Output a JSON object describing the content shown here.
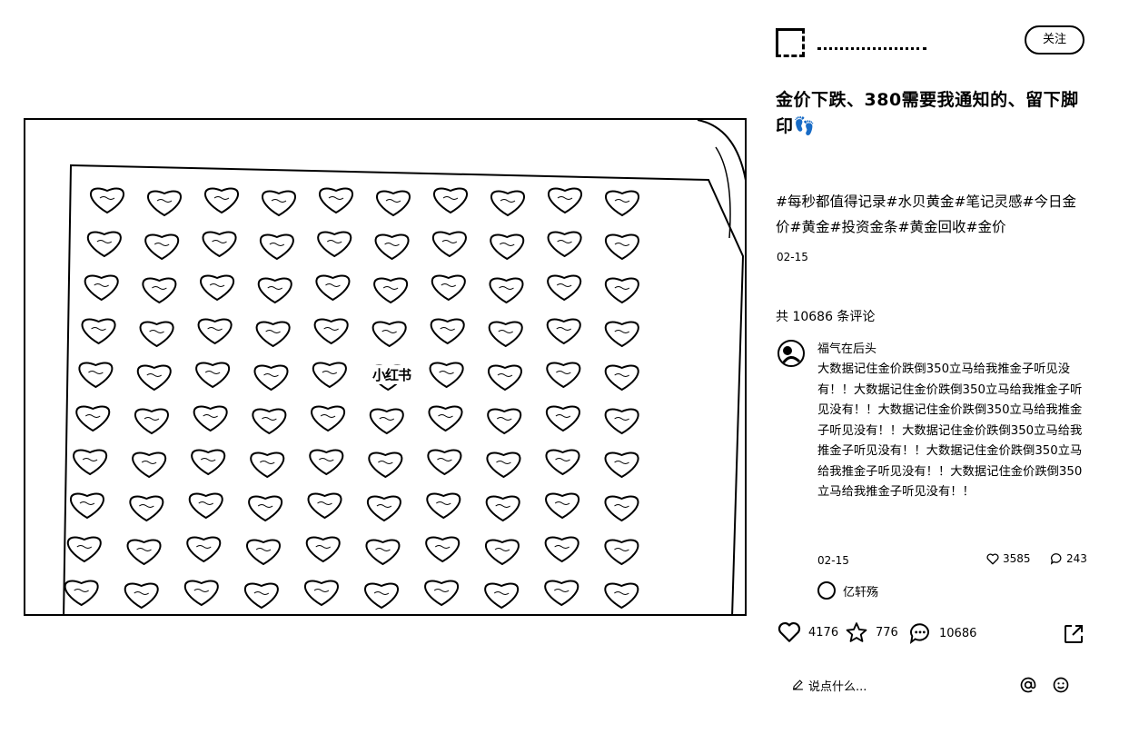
{
  "photo": {
    "watermark": "小红书"
  },
  "author": {
    "name": "",
    "follow_label": "关注"
  },
  "note": {
    "title": "金价下跌、380需要我通知的、留下脚印👣",
    "tags": [
      "#每秒都值得记录",
      "#水贝黄金",
      "#笔记灵感",
      "#今日金价",
      "#黄金",
      "#投资金条",
      "#黄金回收",
      "#金价"
    ],
    "date": "02-15",
    "comment_count_text": "共 10686 条评论"
  },
  "comment": {
    "user": "福气在后头",
    "text": "大数据记住金价跌倒350立马给我推金子听见没有！！大数据记住金价跌倒350立马给我推金子听见没有！！大数据记住金价跌倒350立马给我推金子听见没有！！大数据记住金价跌倒350立马给我推金子听见没有！！大数据记住金价跌倒350立马给我推金子听见没有！！大数据记住金价跌倒350立马给我推金子听见没有！！",
    "date": "02-15",
    "likes": "3585",
    "replies": "243",
    "reply_user": "亿轩殇"
  },
  "actions": {
    "likes": "4176",
    "collects": "776",
    "comments": "10686"
  },
  "input": {
    "placeholder": "说点什么..."
  },
  "icons": [
    "heart-icon",
    "star-icon",
    "comment-bubble-icon",
    "share-icon",
    "pencil-icon",
    "at-icon",
    "emoji-icon"
  ]
}
